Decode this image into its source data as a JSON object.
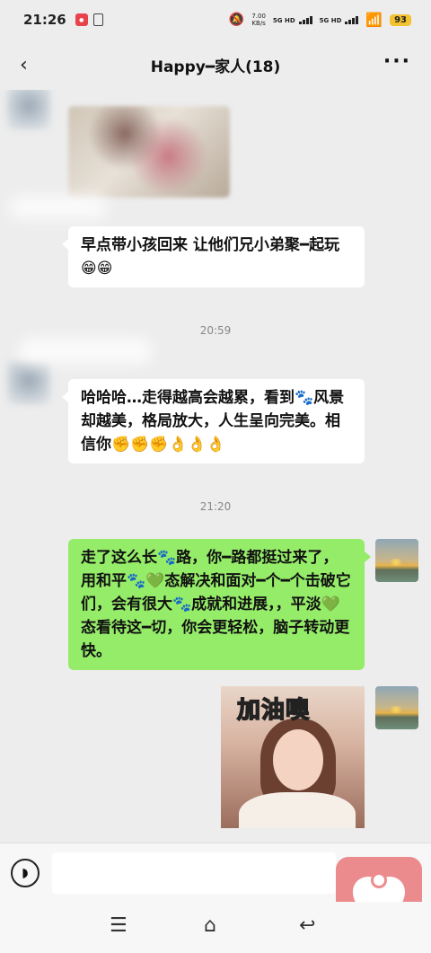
{
  "status_bar": {
    "time": "21:26",
    "net_speed_value": "7.00",
    "net_speed_unit": "KB/s",
    "signal1_label": "5G HD",
    "signal2_label": "5G HD",
    "battery": "93"
  },
  "header": {
    "title": "Happy━家人(18)",
    "more_label": "···"
  },
  "messages": [
    {
      "kind": "image",
      "sender": "other",
      "blurred": true
    },
    {
      "kind": "text",
      "sender": "other",
      "text": "早点带小孩回来 让他们兄小弟聚━起玩😁😁"
    },
    {
      "kind": "time",
      "text": "20:59"
    },
    {
      "kind": "text",
      "sender": "other",
      "text": "哈哈哈…走得越高会越累，看到🐾风景却越美，格局放大，人生呈向完美。相信你✊✊✊👌👌👌"
    },
    {
      "kind": "time",
      "text": "21:20"
    },
    {
      "kind": "text",
      "sender": "self",
      "text": "走了这么长🐾路，你━路都挺过来了，用和平🐾💚态解决和面对━个━个击破它们，会有很大🐾成就和进展，，平淡💚态看待这━切，你会更轻松，脑子转动更快。"
    },
    {
      "kind": "sticker",
      "sender": "self",
      "caption": "加油噢"
    }
  ],
  "input": {
    "placeholder": ""
  },
  "icons": {
    "voice": "voice-icon",
    "back": "back-icon",
    "more": "more-icon",
    "menu": "menu-icon",
    "home": "home-icon",
    "return": "return-icon",
    "heart_app": "heart-icon"
  },
  "colors": {
    "chat_bg": "#ededed",
    "self_bubble": "#95ec69",
    "other_bubble": "#ffffff",
    "battery": "#f2c230",
    "heart_app": "#ec8b8e"
  }
}
